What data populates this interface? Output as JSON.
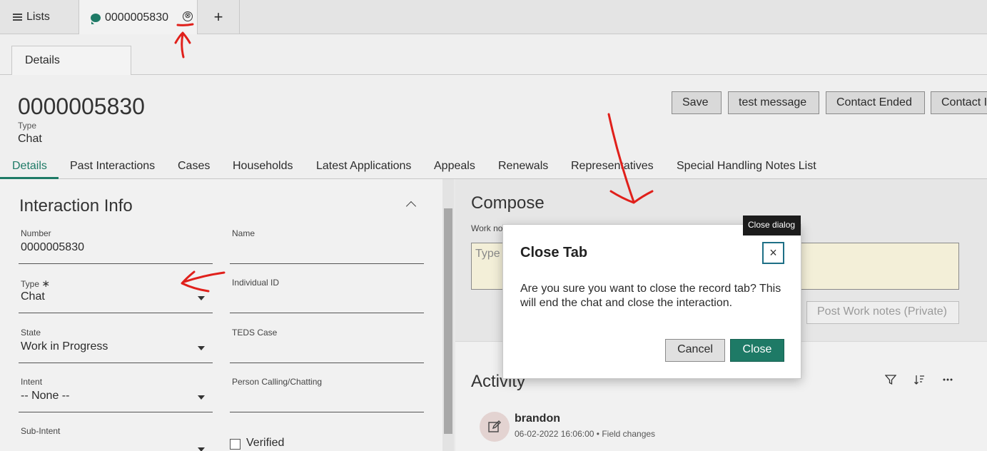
{
  "top_tabs": {
    "lists_label": "Lists",
    "record_label": "0000005830",
    "close_glyph": "⊗",
    "add_glyph": "+"
  },
  "sub_tab": {
    "label": "Details"
  },
  "record": {
    "number": "0000005830",
    "type_label": "Type",
    "type_value": "Chat",
    "buttons": [
      "Save",
      "test message",
      "Contact Ended",
      "Contact I"
    ]
  },
  "nav_tabs": [
    "Details",
    "Past Interactions",
    "Cases",
    "Households",
    "Latest Applications",
    "Appeals",
    "Renewals",
    "Representatives",
    "Special Handling Notes List"
  ],
  "interaction_info": {
    "title": "Interaction Info",
    "number_label": "Number",
    "number_value": "0000005830",
    "name_label": "Name",
    "type_label": "Type",
    "type_required": "∗",
    "type_value": "Chat",
    "individual_id_label": "Individual ID",
    "state_label": "State",
    "state_value": "Work in Progress",
    "teds_case_label": "TEDS Case",
    "intent_label": "Intent",
    "intent_value": "-- None --",
    "person_label": "Person Calling/Chatting",
    "sub_intent_label": "Sub-Intent",
    "verified_label": "Verified"
  },
  "compose": {
    "title": "Compose",
    "work_notes_label": "Work no",
    "placeholder": "Type",
    "post_button": "Post Work notes (Private)"
  },
  "activity": {
    "title": "Activity",
    "user": "brandon",
    "timestamp": "06-02-2022 16:06:00",
    "meta_separator": "•",
    "meta_type": "Field changes"
  },
  "modal": {
    "title": "Close Tab",
    "body": "Are you sure you want to close the record tab? This will end the chat and close the interaction.",
    "cancel": "Cancel",
    "close": "Close",
    "close_x": "×",
    "tooltip": "Close dialog"
  },
  "colors": {
    "accent": "#1e7a66",
    "focus_ring": "#1e6f86",
    "annotation": "#e0201b"
  }
}
